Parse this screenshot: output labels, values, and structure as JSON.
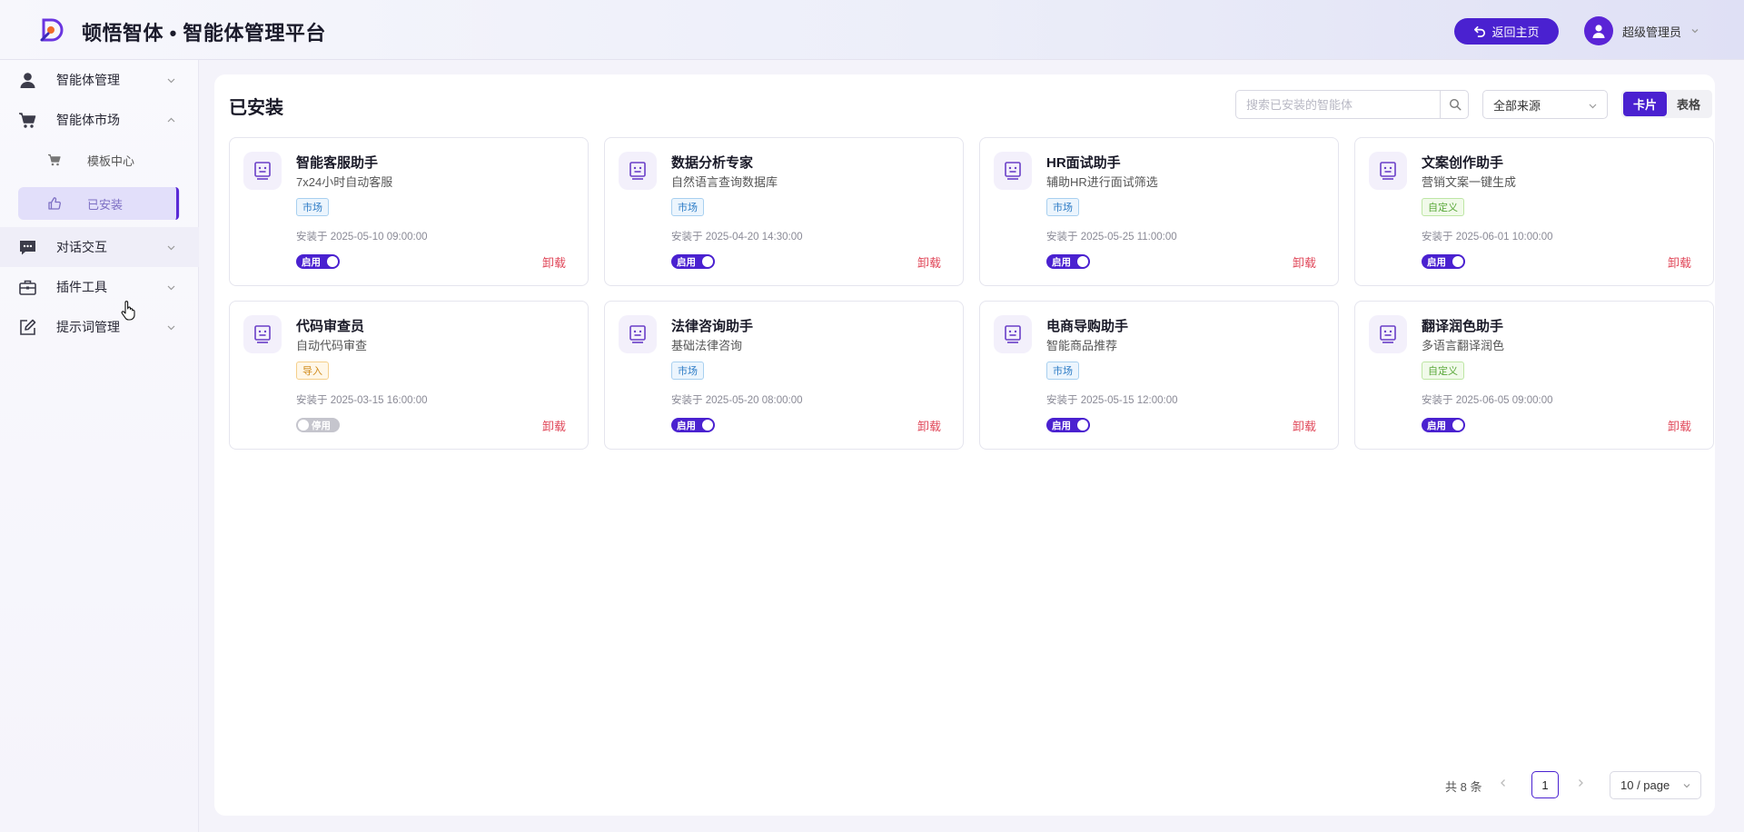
{
  "app": {
    "title": "顿悟智体 • 智能体管理平台"
  },
  "header": {
    "home_label": "返回主页",
    "user_name": "超级管理员"
  },
  "sidebar": {
    "items": [
      {
        "label": "智能体管理",
        "icon": "user-icon"
      },
      {
        "label": "智能体市场",
        "icon": "cart-icon",
        "expanded": true
      },
      {
        "label": "对话交互",
        "icon": "chat-icon"
      },
      {
        "label": "插件工具",
        "icon": "toolbox-icon"
      },
      {
        "label": "提示词管理",
        "icon": "edit-icon"
      }
    ],
    "sub_items": [
      {
        "label": "模板中心",
        "icon": "cart-icon"
      },
      {
        "label": "已安装",
        "icon": "thumb-icon",
        "active": true
      }
    ]
  },
  "main": {
    "title": "已安装",
    "search_placeholder": "搜索已安装的智能体",
    "source_select": "全部来源",
    "view_card": "卡片",
    "view_table": "表格",
    "active_view": "卡片",
    "cards": [
      {
        "name": "智能客服助手",
        "desc": "7x24小时自动客服",
        "tag": "市场",
        "tag_type": "market",
        "time": "安装于 2025-05-10 09:00:00",
        "status": "启用",
        "enabled": true,
        "action": "卸载"
      },
      {
        "name": "数据分析专家",
        "desc": "自然语言查询数据库",
        "tag": "市场",
        "tag_type": "market",
        "time": "安装于 2025-04-20 14:30:00",
        "status": "启用",
        "enabled": true,
        "action": "卸载"
      },
      {
        "name": "HR面试助手",
        "desc": "辅助HR进行面试筛选",
        "tag": "市场",
        "tag_type": "market",
        "time": "安装于 2025-05-25 11:00:00",
        "status": "启用",
        "enabled": true,
        "action": "卸载"
      },
      {
        "name": "文案创作助手",
        "desc": "营销文案一键生成",
        "tag": "自定义",
        "tag_type": "custom",
        "time": "安装于 2025-06-01 10:00:00",
        "status": "启用",
        "enabled": true,
        "action": "卸载"
      },
      {
        "name": "代码审查员",
        "desc": "自动代码审查",
        "tag": "导入",
        "tag_type": "import",
        "time": "安装于 2025-03-15 16:00:00",
        "status": "停用",
        "enabled": false,
        "action": "卸载"
      },
      {
        "name": "法律咨询助手",
        "desc": "基础法律咨询",
        "tag": "市场",
        "tag_type": "market",
        "time": "安装于 2025-05-20 08:00:00",
        "status": "启用",
        "enabled": true,
        "action": "卸载"
      },
      {
        "name": "电商导购助手",
        "desc": "智能商品推荐",
        "tag": "市场",
        "tag_type": "market",
        "time": "安装于 2025-05-15 12:00:00",
        "status": "启用",
        "enabled": true,
        "action": "卸载"
      },
      {
        "name": "翻译润色助手",
        "desc": "多语言翻译润色",
        "tag": "自定义",
        "tag_type": "custom",
        "time": "安装于 2025-06-05 09:00:00",
        "status": "启用",
        "enabled": true,
        "action": "卸载"
      }
    ]
  },
  "pagination": {
    "total": "共 8 条",
    "current": "1",
    "page_size": "10 / page"
  },
  "colors": {
    "accent": "#4a21d0",
    "danger": "#e0485a",
    "market_tag": "#2d7cc6",
    "custom_tag": "#5aa83a",
    "import_tag": "#d08b1c"
  }
}
